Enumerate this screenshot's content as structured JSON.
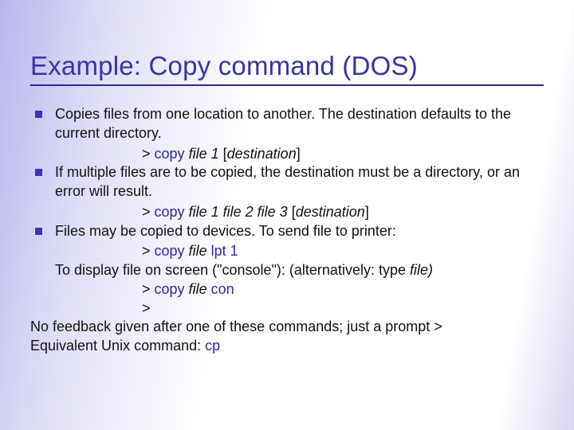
{
  "title": "Example: Copy command (DOS)",
  "bullets": [
    "Copies files from one location to another. The destination defaults to the current directory.",
    "If multiple files are to be copied, the destination must be a directory, or an error will result.",
    "Files may be copied to devices. To send file to printer:"
  ],
  "cmd": {
    "copy": "copy",
    "file1": "file 1",
    "file2": "file 2",
    "file3": "file 3",
    "dest_open": "[",
    "dest": "destination",
    "dest_close": "]",
    "file": "file",
    "lpt1": "lpt 1",
    "con": "con",
    "cp": "cp",
    "prompt": ">"
  },
  "lines": {
    "console_pre": "To display file on screen (\"console\"):  (alternatively: type ",
    "console_post": ")",
    "nofeedback": "No feedback given after one of these commands; just a prompt >",
    "equiv_pre": "Equivalent Unix command: "
  }
}
